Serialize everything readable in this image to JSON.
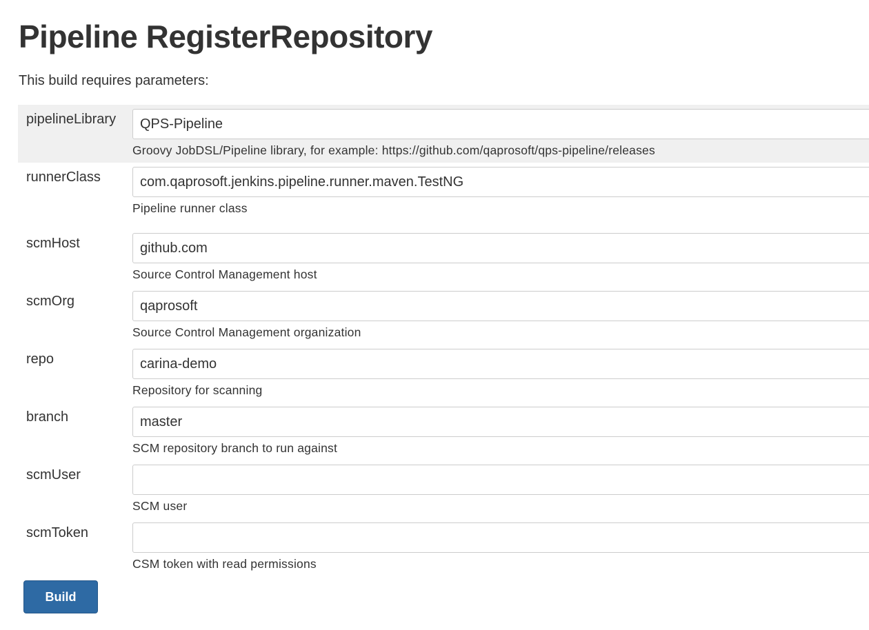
{
  "page": {
    "title": "Pipeline RegisterRepository",
    "intro": "This build requires parameters:"
  },
  "params": [
    {
      "name": "pipelineLibrary",
      "value": "QPS-Pipeline",
      "description": "Groovy JobDSL/Pipeline library, for example: https://github.com/qaprosoft/qps-pipeline/releases"
    },
    {
      "name": "runnerClass",
      "value": "com.qaprosoft.jenkins.pipeline.runner.maven.TestNG",
      "description": "Pipeline runner class"
    },
    {
      "name": "scmHost",
      "value": "github.com",
      "description": "Source Control Management host"
    },
    {
      "name": "scmOrg",
      "value": "qaprosoft",
      "description": "Source Control Management organization"
    },
    {
      "name": "repo",
      "value": "carina-demo",
      "description": "Repository for scanning"
    },
    {
      "name": "branch",
      "value": "master",
      "description": "SCM repository branch to run against"
    },
    {
      "name": "scmUser",
      "value": "",
      "description": "SCM user"
    },
    {
      "name": "scmToken",
      "value": "",
      "description": "CSM token with read permissions"
    }
  ],
  "actions": {
    "build_label": "Build"
  },
  "colors": {
    "build_button": "#2e6aa4",
    "highlight_row": "#f0f0f0",
    "text": "#333333"
  }
}
